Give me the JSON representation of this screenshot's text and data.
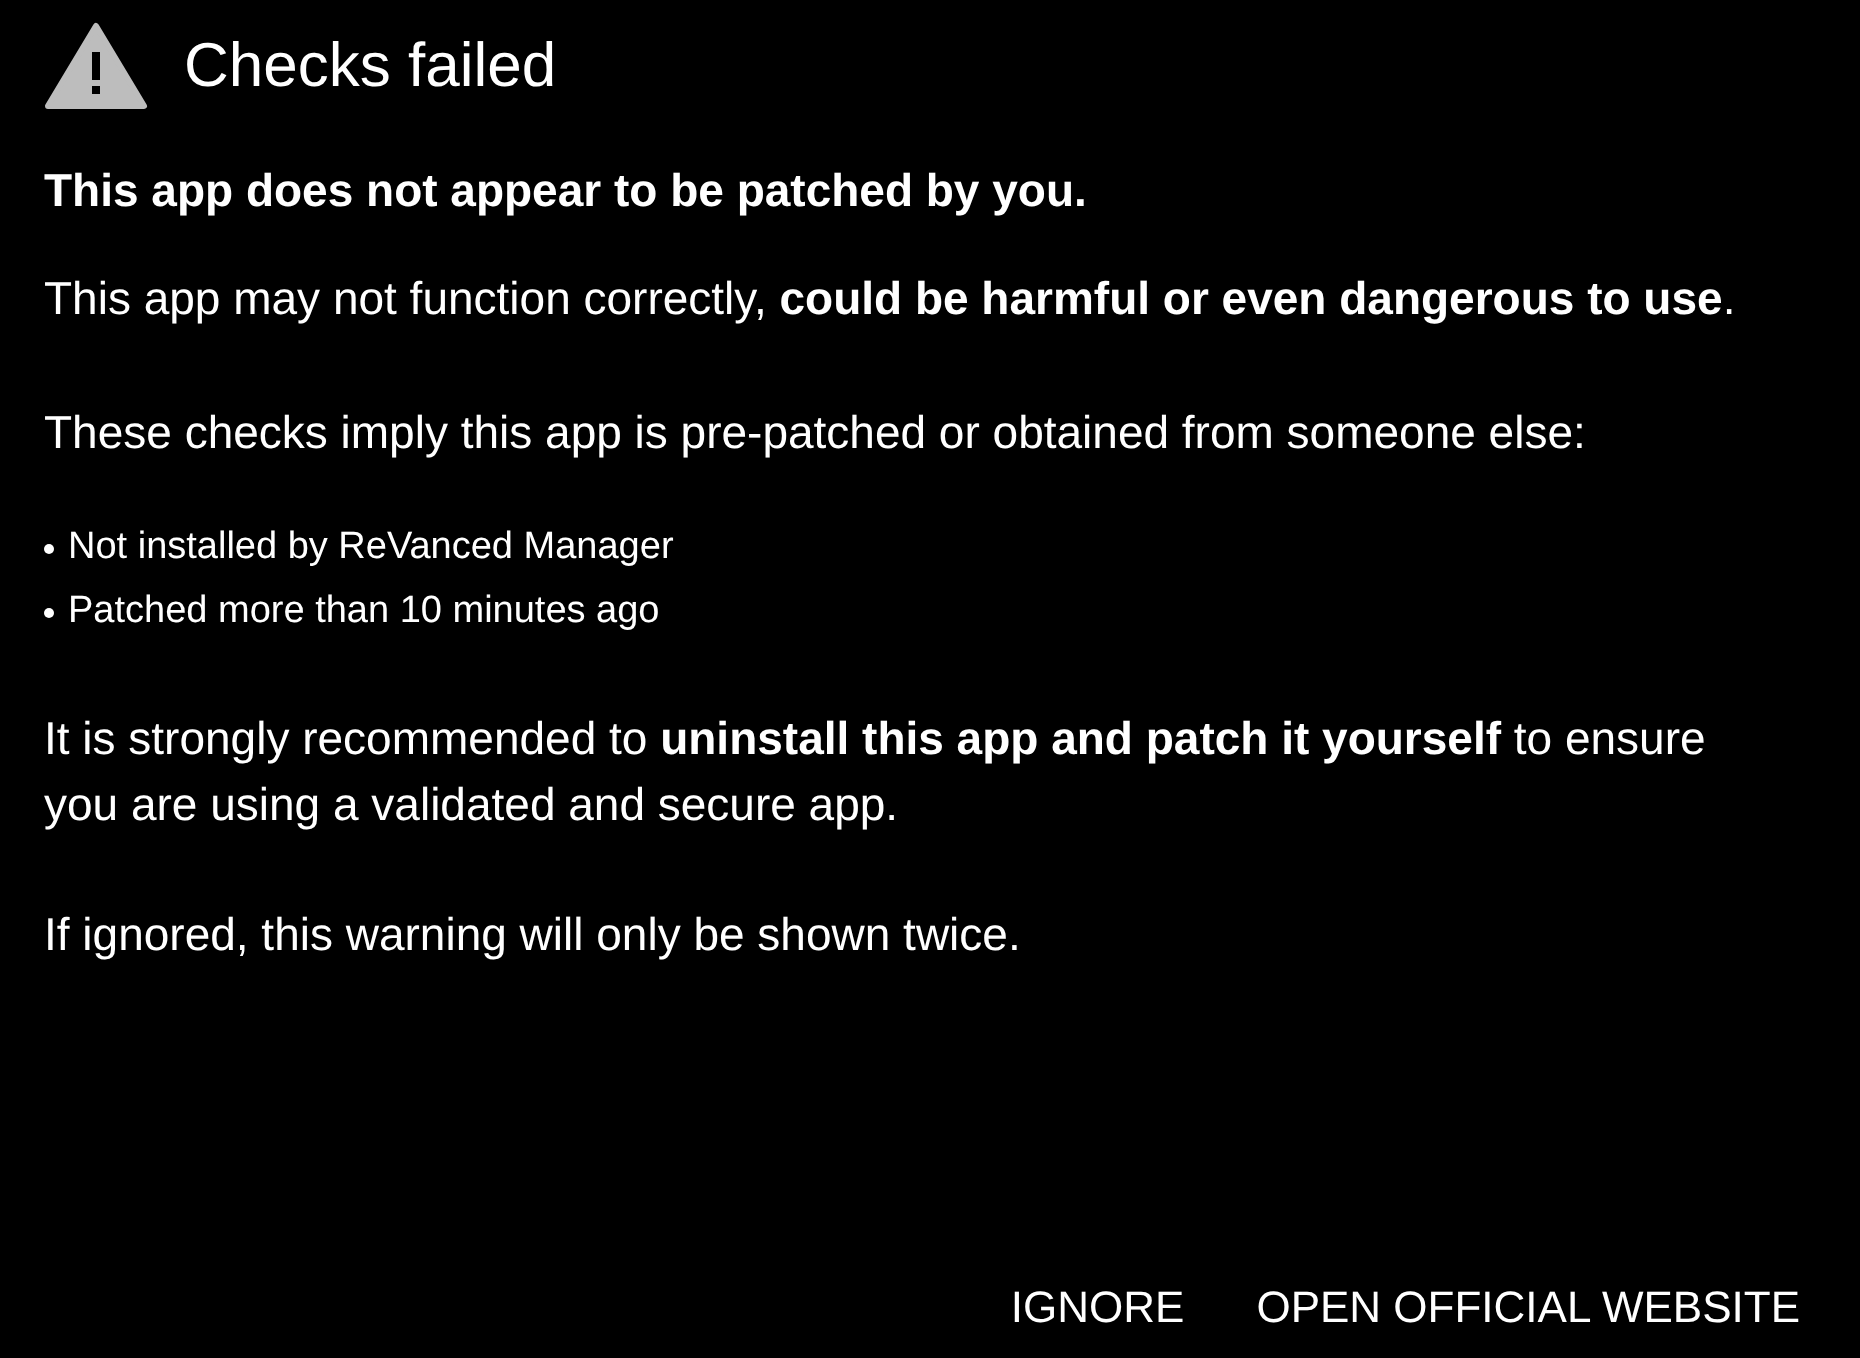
{
  "dialog": {
    "title": "Checks failed",
    "subtitle": "This app does not appear to be patched by you.",
    "paragraphs_top": [
      "This app may not function correctly, **could be harmful or even dangerous to use**.",
      "These checks imply this app is pre-patched or obtained from someone else:"
    ],
    "reasons": [
      "Not installed by ReVanced Manager",
      "Patched more than 10 minutes ago"
    ],
    "paragraphs_bottom": [
      "It is strongly recommended to **uninstall this app and patch it yourself** to ensure you are using a validated and secure app.",
      "If ignored, this warning will only be shown twice."
    ],
    "buttons": [
      "IGNORE",
      "OPEN OFFICIAL WEBSITE"
    ]
  }
}
